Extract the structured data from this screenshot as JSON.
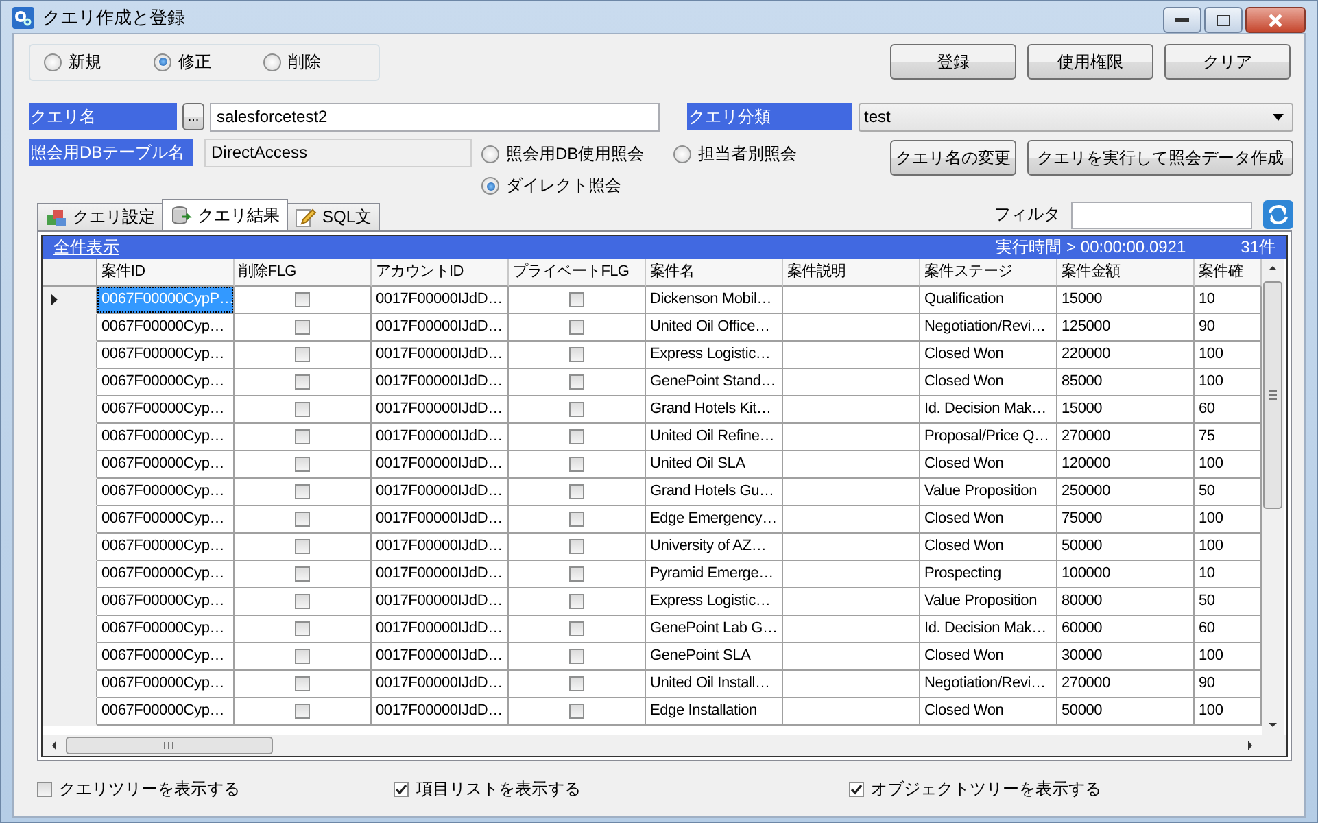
{
  "window": {
    "title": "クエリ作成と登録"
  },
  "mode_options": [
    {
      "label": "新規",
      "selected": false
    },
    {
      "label": "修正",
      "selected": true
    },
    {
      "label": "削除",
      "selected": false
    }
  ],
  "buttons": [
    "登録",
    "使用権限",
    "クリア"
  ],
  "query_name": {
    "label": "クエリ名",
    "browse_button": "...",
    "value": "salesforcetest2"
  },
  "query_category": {
    "label": "クエリ分類",
    "value": "test"
  },
  "table_name": {
    "label": "照会用DBテーブル名",
    "value": "DirectAccess"
  },
  "query_type_options": [
    {
      "label": "照会用DB使用照会",
      "selected": false
    },
    {
      "label": "担当者別照会",
      "selected": false
    },
    {
      "label": "ダイレクト照会",
      "selected": true
    }
  ],
  "action_buttons": [
    "クエリ名の変更",
    "クエリを実行して照会データ作成"
  ],
  "tabs": [
    {
      "label": "クエリ設定",
      "selected": false
    },
    {
      "label": "クエリ結果",
      "selected": true
    },
    {
      "label": "SQL文",
      "selected": false
    }
  ],
  "filter": {
    "label": "フィルタ"
  },
  "results": {
    "show_all": "全件表示",
    "elapsed": "実行時間 > 00:00:00.0921",
    "count": "31件",
    "columns": [
      {
        "label": "案件ID",
        "kind": "text"
      },
      {
        "label": "削除FLG",
        "kind": "check"
      },
      {
        "label": "アカウントID",
        "kind": "text"
      },
      {
        "label": "プライベートFLG",
        "kind": "check"
      },
      {
        "label": "案件名",
        "kind": "text"
      },
      {
        "label": "案件説明",
        "kind": "text"
      },
      {
        "label": "案件ステージ",
        "kind": "text"
      },
      {
        "label": "案件金額",
        "kind": "text"
      },
      {
        "label": "案件確",
        "kind": "text"
      }
    ],
    "rows": [
      {
        "selected": true,
        "case_id": "0067F00000CypP…",
        "deleted": false,
        "account_id": "0017F00000IJdD…",
        "private": false,
        "case_name": "Dickenson Mobil…",
        "stage": "Qualification",
        "amount": "15000",
        "probability": "10"
      },
      {
        "selected": false,
        "case_id": "0067F00000Cyp…",
        "deleted": false,
        "account_id": "0017F00000IJdD…",
        "private": false,
        "case_name": "United Oil Office…",
        "stage": "Negotiation/Revi…",
        "amount": "125000",
        "probability": "90"
      },
      {
        "selected": false,
        "case_id": "0067F00000Cyp…",
        "deleted": false,
        "account_id": "0017F00000IJdD…",
        "private": false,
        "case_name": "Express Logistic…",
        "stage": "Closed Won",
        "amount": "220000",
        "probability": "100"
      },
      {
        "selected": false,
        "case_id": "0067F00000Cyp…",
        "deleted": false,
        "account_id": "0017F00000IJdD…",
        "private": false,
        "case_name": "GenePoint Stand…",
        "stage": "Closed Won",
        "amount": "85000",
        "probability": "100"
      },
      {
        "selected": false,
        "case_id": "0067F00000Cyp…",
        "deleted": false,
        "account_id": "0017F00000IJdD…",
        "private": false,
        "case_name": "Grand Hotels Kit…",
        "stage": "Id. Decision Mak…",
        "amount": "15000",
        "probability": "60"
      },
      {
        "selected": false,
        "case_id": "0067F00000Cyp…",
        "deleted": false,
        "account_id": "0017F00000IJdD…",
        "private": false,
        "case_name": "United Oil Refine…",
        "stage": "Proposal/Price Q…",
        "amount": "270000",
        "probability": "75"
      },
      {
        "selected": false,
        "case_id": "0067F00000Cyp…",
        "deleted": false,
        "account_id": "0017F00000IJdD…",
        "private": false,
        "case_name": "United Oil SLA",
        "stage": "Closed Won",
        "amount": "120000",
        "probability": "100"
      },
      {
        "selected": false,
        "case_id": "0067F00000Cyp…",
        "deleted": false,
        "account_id": "0017F00000IJdD…",
        "private": false,
        "case_name": "Grand Hotels Gu…",
        "stage": "Value Proposition",
        "amount": "250000",
        "probability": "50"
      },
      {
        "selected": false,
        "case_id": "0067F00000Cyp…",
        "deleted": false,
        "account_id": "0017F00000IJdD…",
        "private": false,
        "case_name": "Edge Emergency…",
        "stage": "Closed Won",
        "amount": "75000",
        "probability": "100"
      },
      {
        "selected": false,
        "case_id": "0067F00000Cyp…",
        "deleted": false,
        "account_id": "0017F00000IJdD…",
        "private": false,
        "case_name": "University of AZ…",
        "stage": "Closed Won",
        "amount": "50000",
        "probability": "100"
      },
      {
        "selected": false,
        "case_id": "0067F00000Cyp…",
        "deleted": false,
        "account_id": "0017F00000IJdD…",
        "private": false,
        "case_name": "Pyramid Emerge…",
        "stage": "Prospecting",
        "amount": "100000",
        "probability": "10"
      },
      {
        "selected": false,
        "case_id": "0067F00000Cyp…",
        "deleted": false,
        "account_id": "0017F00000IJdD…",
        "private": false,
        "case_name": "Express Logistic…",
        "stage": "Value Proposition",
        "amount": "80000",
        "probability": "50"
      },
      {
        "selected": false,
        "case_id": "0067F00000Cyp…",
        "deleted": false,
        "account_id": "0017F00000IJdD…",
        "private": false,
        "case_name": "GenePoint Lab G…",
        "stage": "Id. Decision Mak…",
        "amount": "60000",
        "probability": "60"
      },
      {
        "selected": false,
        "case_id": "0067F00000Cyp…",
        "deleted": false,
        "account_id": "0017F00000IJdD…",
        "private": false,
        "case_name": "GenePoint SLA",
        "stage": "Closed Won",
        "amount": "30000",
        "probability": "100"
      },
      {
        "selected": false,
        "case_id": "0067F00000Cyp…",
        "deleted": false,
        "account_id": "0017F00000IJdD…",
        "private": false,
        "case_name": "United Oil Install…",
        "stage": "Negotiation/Revi…",
        "amount": "270000",
        "probability": "90"
      },
      {
        "selected": false,
        "case_id": "0067F00000Cyp…",
        "deleted": false,
        "account_id": "0017F00000IJdD…",
        "private": false,
        "case_name": "Edge Installation",
        "stage": "Closed Won",
        "amount": "50000",
        "probability": "100"
      }
    ]
  },
  "footer_options": [
    {
      "label": "クエリツリーを表示する",
      "checked": false
    },
    {
      "label": "項目リストを表示する",
      "checked": true
    },
    {
      "label": "オブジェクトツリーを表示する",
      "checked": true
    }
  ]
}
